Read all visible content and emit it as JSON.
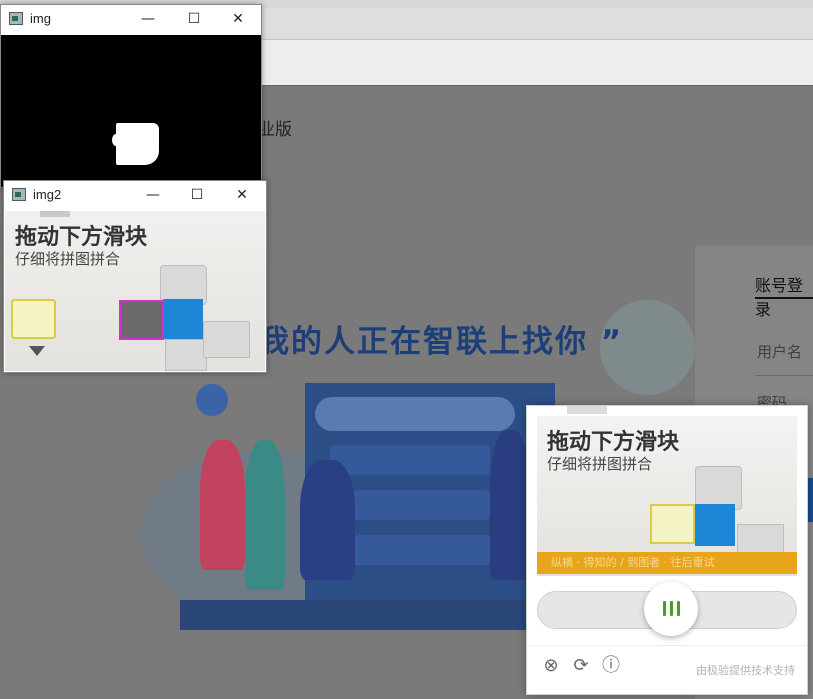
{
  "browser": {
    "site_suffix": "业版",
    "slogan": "我的人正在智联上找你 ”",
    "login": {
      "tab_label": "账号登录",
      "username_placeholder": "用户名",
      "password_placeholder": "密码"
    }
  },
  "windows": {
    "img": {
      "title": "img",
      "minimize": "—",
      "maximize": "☐",
      "close": "✕"
    },
    "img2": {
      "title": "img2",
      "minimize": "—",
      "maximize": "☐",
      "close": "✕"
    }
  },
  "captcha": {
    "title": "拖动下方滑块",
    "subtitle": "仔细将拼图拼合",
    "banner": "纵横 · 得知的 / 到图者 · 往后重试",
    "brand": "由极验提供技术支持",
    "icons": [
      "close-circle-icon",
      "refresh-icon",
      "info-icon"
    ],
    "accent_color": "#e8a51c",
    "knob_color": "#46a01e"
  }
}
